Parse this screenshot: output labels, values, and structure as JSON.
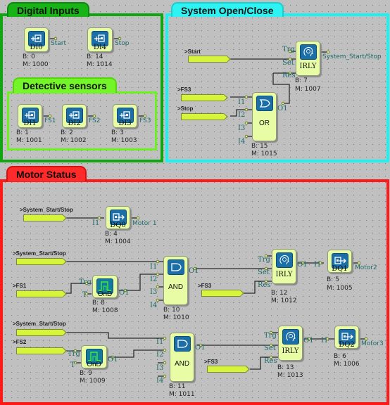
{
  "groups": {
    "digital_inputs": {
      "title": "Digital Inputs",
      "color": "#11a611"
    },
    "detective_sensors": {
      "title": "Detective sensors",
      "color": "#6cf21c"
    },
    "system_open_close": {
      "title": "System  Open/Close",
      "color": "#1ff0f0"
    },
    "motor_status": {
      "title": "Motor Status",
      "color": "#ff1a1a"
    }
  },
  "blocks": {
    "di0": {
      "name": "DI0",
      "b": "B: 0",
      "m": "M: 1000",
      "output": "Start"
    },
    "di4": {
      "name": "DI4",
      "b": "B: 14",
      "m": "M: 1014",
      "output": "Stop"
    },
    "di1": {
      "name": "DI1",
      "b": "B: 1",
      "m": "M: 1001",
      "output": "FS1"
    },
    "di2": {
      "name": "DI2",
      "b": "B: 2",
      "m": "M: 1002",
      "output": "FS2"
    },
    "di3": {
      "name": "DI3",
      "b": "B: 3",
      "m": "M: 1003",
      "output": "FS3"
    },
    "irly7": {
      "name": "IRLY",
      "b": "B: 7",
      "m": "M: 1007",
      "output": "System_Start/Stop",
      "pins": [
        "Trg",
        "Set",
        "Res"
      ]
    },
    "or15": {
      "name": "OR",
      "b": "B: 15",
      "m": "M: 1015",
      "pins": [
        "I1",
        "I2",
        "I3",
        "I4"
      ],
      "out": "O1"
    },
    "dq0": {
      "name": "DQ0",
      "b": "B: 4",
      "m": "M: 1004",
      "in": "I1",
      "output": "Motor 1"
    },
    "ond8": {
      "name": "OnD",
      "b": "B: 8",
      "m": "M: 1008",
      "pins": [
        "Trg",
        "T"
      ],
      "out": "O1"
    },
    "and10": {
      "name": "AND",
      "b": "B: 10",
      "m": "M: 1010",
      "pins": [
        "I1",
        "I2",
        "I3",
        "I4"
      ],
      "out": "O1"
    },
    "irly12": {
      "name": "IRLY",
      "b": "B: 12",
      "m": "M: 1012",
      "pins": [
        "Trg",
        "Set",
        "Res"
      ],
      "out": "O1"
    },
    "dq1": {
      "name": "DQ1",
      "b": "B: 5",
      "m": "M: 1005",
      "in": "I1",
      "output": "Motor2"
    },
    "ond9": {
      "name": "OnD",
      "b": "B: 9",
      "m": "M: 1009",
      "pins": [
        "Trg",
        "T"
      ],
      "out": "O1"
    },
    "and11": {
      "name": "AND",
      "b": "B: 11",
      "m": "M: 1011",
      "pins": [
        "I1",
        "I2",
        "I3",
        "I4"
      ],
      "out": "O1"
    },
    "irly13": {
      "name": "IRLY",
      "b": "B: 13",
      "m": "M: 1013",
      "pins": [
        "Trg",
        "Set",
        "Res"
      ],
      "out": "O1"
    },
    "dq2": {
      "name": "DQ2",
      "b": "B: 6",
      "m": "M: 1006",
      "in": "I1",
      "output": "Motor3"
    }
  },
  "tags": {
    "start": ">Start",
    "fs3_a": ">FS3",
    "stop": ">Stop",
    "sss_1": ">System_Start/Stop",
    "sss_2": ">System_Start/Stop",
    "fs1": ">FS1",
    "fs3_b": ">FS3",
    "sss_3": ">System_Start/Stop",
    "fs2": ">FS2",
    "fs3_c": ">FS3"
  }
}
